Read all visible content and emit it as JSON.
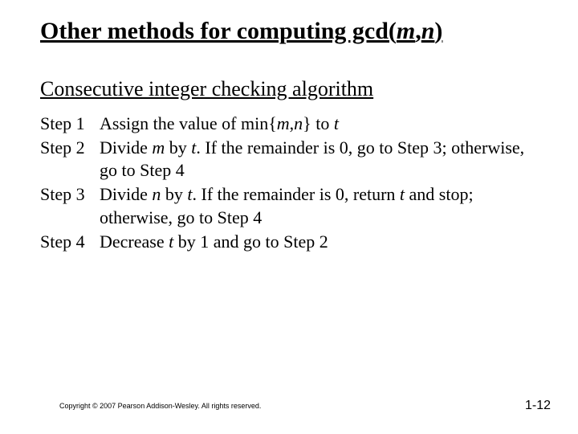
{
  "title": {
    "part1": "Other methods for computing gcd(",
    "m": "m",
    "comma": ",",
    "n": "n",
    "part2": ")"
  },
  "subtitle": "Consecutive integer checking algorithm",
  "steps": [
    {
      "label": "Step 1",
      "parts": [
        {
          "t": "Assign the value of min{"
        },
        {
          "t": "m",
          "i": true
        },
        {
          "t": ","
        },
        {
          "t": "n",
          "i": true
        },
        {
          "t": "} to "
        },
        {
          "t": "t",
          "i": true
        }
      ]
    },
    {
      "label": "Step 2",
      "parts": [
        {
          "t": "Divide "
        },
        {
          "t": "m",
          "i": true
        },
        {
          "t": " by "
        },
        {
          "t": "t",
          "i": true
        },
        {
          "t": ".  If the remainder is 0, go to Step 3; otherwise, go to Step 4"
        }
      ]
    },
    {
      "label": "Step 3",
      "parts": [
        {
          "t": "Divide "
        },
        {
          "t": "n",
          "i": true
        },
        {
          "t": " by "
        },
        {
          "t": "t",
          "i": true
        },
        {
          "t": ".  If the remainder is 0, return "
        },
        {
          "t": "t",
          "i": true
        },
        {
          "t": " and stop; otherwise, go to Step 4"
        }
      ]
    },
    {
      "label": "Step 4",
      "parts": [
        {
          "t": "Decrease "
        },
        {
          "t": "t",
          "i": true
        },
        {
          "t": " by 1 and go to Step 2"
        }
      ]
    }
  ],
  "copyright": "Copyright © 2007 Pearson Addison-Wesley. All rights reserved.",
  "pagenum": "1-12"
}
